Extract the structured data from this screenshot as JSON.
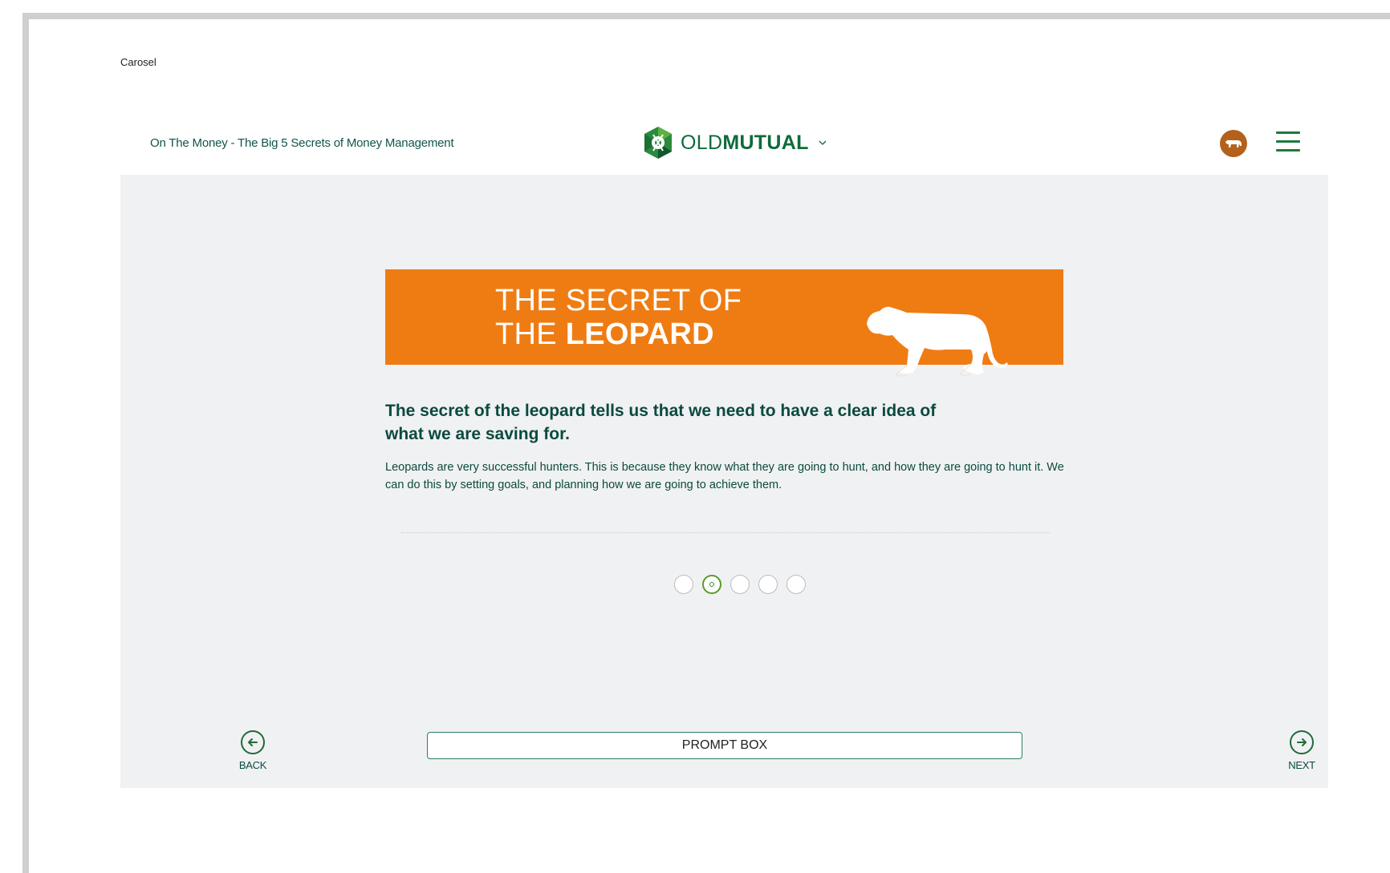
{
  "page_label": "Carosel",
  "header": {
    "course_title": "On The Money - The Big 5 Secrets of Money Management",
    "logo_text_light": "OLD",
    "logo_text_bold": "MUTUAL"
  },
  "slide": {
    "banner_line1": "THE SECRET OF",
    "banner_line2_prefix": "THE ",
    "banner_line2_bold": "LEOPARD",
    "headline": "The secret of the leopard tells us that we need to have a clear idea of what we are saving for.",
    "body": "Leopards are very successful hunters. This is because they know what they are going to hunt, and how they are going to hunt it. We can do this by setting goals, and planning how we are going to achieve them."
  },
  "carousel": {
    "total": 5,
    "active_index": 1
  },
  "prompt_label": "PROMPT BOX",
  "nav": {
    "back_label": "BACK",
    "next_label": "NEXT"
  },
  "colors": {
    "brand_green": "#0e6b3b",
    "banner_orange": "#ef7c13",
    "avatar_brown": "#b4611d",
    "text_dark_green": "#0b4a3f"
  }
}
